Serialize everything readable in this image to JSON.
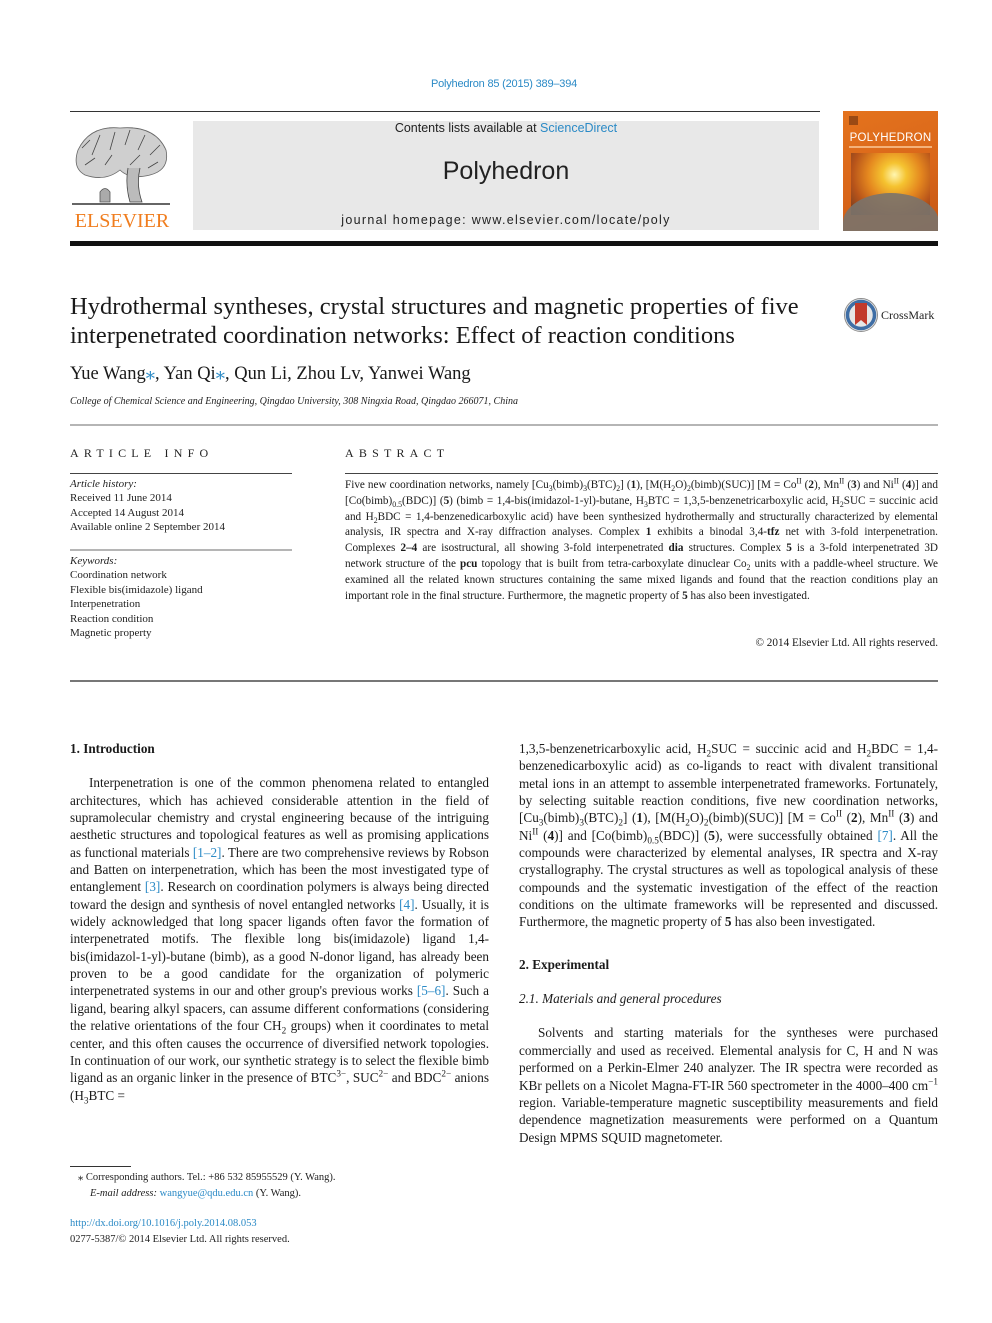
{
  "header": {
    "citation": "Polyhedron 85 (2015) 389–394",
    "contents_prefix": "Contents lists available at ",
    "contents_link": "ScienceDirect",
    "journal_title": "Polyhedron",
    "homepage_prefix": "journal homepage: ",
    "homepage_url": "www.elsevier.com/locate/poly",
    "publisher_logo_text": "ELSEVIER",
    "cover_title": "POLYHEDRON",
    "publisher_color": "#f07d1e",
    "cover_color": "#e4731d",
    "link_color": "#2b8ac6"
  },
  "article": {
    "title": "Hydrothermal syntheses, crystal structures and magnetic properties of five interpenetrated coordination networks: Effect of reaction conditions",
    "crossmark_label": "CrossMark",
    "authors": [
      {
        "name": "Yue Wang",
        "corresponding": true
      },
      {
        "name": "Yan Qi",
        "corresponding": true
      },
      {
        "name": "Qun Li",
        "corresponding": false
      },
      {
        "name": "Zhou Lv",
        "corresponding": false
      },
      {
        "name": "Yanwei Wang",
        "corresponding": false
      }
    ],
    "author_separator": ", ",
    "corresponding_mark": "⁎",
    "affiliation": "College of Chemical Science and Engineering, Qingdao University, 308 Ningxia Road, Qingdao 266071, China"
  },
  "article_info": {
    "heading": "ARTICLE INFO",
    "history_label": "Article history:",
    "history": [
      "Received 11 June 2014",
      "Accepted 14 August 2014",
      "Available online 2 September 2014"
    ],
    "keywords_label": "Keywords:",
    "keywords": [
      "Coordination network",
      "Flexible bis(imidazole) ligand",
      "Interpenetration",
      "Reaction condition",
      "Magnetic property"
    ]
  },
  "abstract": {
    "heading": "ABSTRACT",
    "parts": {
      "p1": "Five new coordination networks, namely [Cu",
      "p2": "(bimb)",
      "p3": "(BTC)",
      "p4": "] (",
      "p5": "), [M(H",
      "p6": "O)",
      "p7": "(bimb)(SUC)] [M = Co",
      "p8": " (",
      "p9": "), Mn",
      "p10": " (",
      "p11": ") and Ni",
      "p12": " (",
      "p13": ")] and [Co(bimb)",
      "p14": "(BDC)] (",
      "p15": ") (bimb = 1,4-bis(imidazol-1-yl)-butane, H",
      "p16": "BTC = 1,3,5-benzenetricarboxylic acid, H",
      "p17": "SUC = succinic acid and H",
      "p18": "BDC = 1,4-benzenedicarboxylic acid) have been synthesized hydrothermally and structurally characterized by elemental analysis, IR spectra and X-ray diffraction analyses. Complex ",
      "p19": " exhibits a binodal 3,4-",
      "p20": " net with 3-fold interpenetration. Complexes ",
      "p21": " are isostructural, all showing 3-fold interpenetrated ",
      "p22": " structures. Complex ",
      "p23": " is a 3-fold interpenetrated 3D network structure of the ",
      "p24": " topology that is built from tetra-carboxylate dinuclear Co",
      "p25": " units with a paddle-wheel structure. We examined all the related known structures containing the same mixed ligands and found that the reaction conditions play an important role in the final structure. Furthermore, the magnetic property of ",
      "p26": " has also been investigated."
    },
    "bold": {
      "c1": "1",
      "c2": "2",
      "c3": "3",
      "c4": "4",
      "c5": "5",
      "tfz": "tfz",
      "range": "2–4",
      "dia": "dia",
      "pcu": "pcu",
      "c1b": "1",
      "c5b": "5",
      "c5c": "5"
    },
    "sub": {
      "three": "3",
      "two": "2",
      "half": "0.5",
      "ii": "II"
    },
    "copyright": "© 2014 Elsevier Ltd. All rights reserved."
  },
  "body": {
    "intro_heading": "1. Introduction",
    "intro": {
      "t1": "Interpenetration is one of the common phenomena related to entangled architectures, which has achieved considerable attention in the field of supramolecular chemistry and crystal engineering because of the intriguing aesthetic structures and topological features as well as promising applications as functional materials ",
      "r1": "[1–2]",
      "t2": ". There are two comprehensive reviews by Robson and Batten on interpenetration, which has been the most investigated type of entanglement ",
      "r2": "[3]",
      "t3": ". Research on coordination polymers is always being directed toward the design and synthesis of novel entangled networks ",
      "r3": "[4]",
      "t4": ". Usually, it is widely acknowledged that long spacer ligands often favor the formation of interpenetrated motifs. The flexible long bis(imidazole) ligand 1,4-bis(imidazol-1-yl)-butane (bimb), as a good N-donor ligand, has already been proven to be a good candidate for the organization of polymeric interpenetrated systems in our and other group's previous works ",
      "r4": "[5–6]",
      "t5": ". Such a ligand, bearing alkyl spacers, can assume different conformations (considering the relative orientations of the four CH",
      "t6": " groups) when it coordinates to metal center, and this often causes the occurrence of diversified network topologies. In continuation of our work, our synthetic strategy is to select the flexible bimb ligand as an organic linker in the presence of BTC",
      "sup1": "3−",
      "t7": ", SUC",
      "sup2": "2−",
      "t8": " and BDC",
      "sup3": "2−",
      "t9": " anions (H",
      "t10": "BTC = 1,3,5-benzenetricarboxylic acid, H",
      "t11": "SUC = succinic acid and H",
      "t12": "BDC = 1,4-benzenedicarboxylic acid) as co-ligands to react with divalent transitional metal ions in an attempt to assemble interpenetrated frameworks. Fortunately, by selecting suitable reaction conditions, five new coordination networks, [Cu",
      "t13": "(bimb)",
      "t14": "(BTC)",
      "t15": "] (",
      "t16": "), [M(H",
      "t17": "O)",
      "t18": "(bimb)(SUC)] [M = Co",
      "t19": " (",
      "t20": "), Mn",
      "t21": " (",
      "t22": ") and Ni",
      "t23": " (",
      "t24": ")] and [Co(bimb)",
      "t25": "(BDC)] (",
      "t26": "), were successfully obtained ",
      "r5": "[7]",
      "t27": ". All the compounds were characterized by elemental analyses, IR spectra and X-ray crystallography. The crystal structures as well as topological analysis of these compounds and the systematic investigation of the effect of the reaction conditions on the ultimate frameworks will be represented and discussed. Furthermore, the magnetic property of ",
      "t28": " has also been investigated."
    },
    "exp_heading": "2. Experimental",
    "exp_sub_heading": "2.1. Materials and general procedures",
    "exp": {
      "t1": "Solvents and starting materials for the syntheses were purchased commercially and used as received. Elemental analysis for C, H and N was performed on a Perkin-Elmer 240 analyzer. The IR spectra were recorded as KBr pellets on a Nicolet Magna-FT-IR 560 spectrometer in the 4000–400 cm",
      "sup": "−1",
      "t2": " region. Variable-temperature magnetic susceptibility measurements and field dependence magnetization measurements were performed on a Quantum Design MPMS SQUID magnetometer."
    }
  },
  "footnote": {
    "mark": "⁎",
    "corresponding": " Corresponding authors. Tel.: +86 532 85955529 (Y. Wang).",
    "email_label": "E-mail address: ",
    "email": "wangyue@qdu.edu.cn",
    "email_suffix": " (Y. Wang).",
    "doi": "http://dx.doi.org/10.1016/j.poly.2014.08.053",
    "issn_copyright": "0277-5387/© 2014 Elsevier Ltd. All rights reserved."
  }
}
